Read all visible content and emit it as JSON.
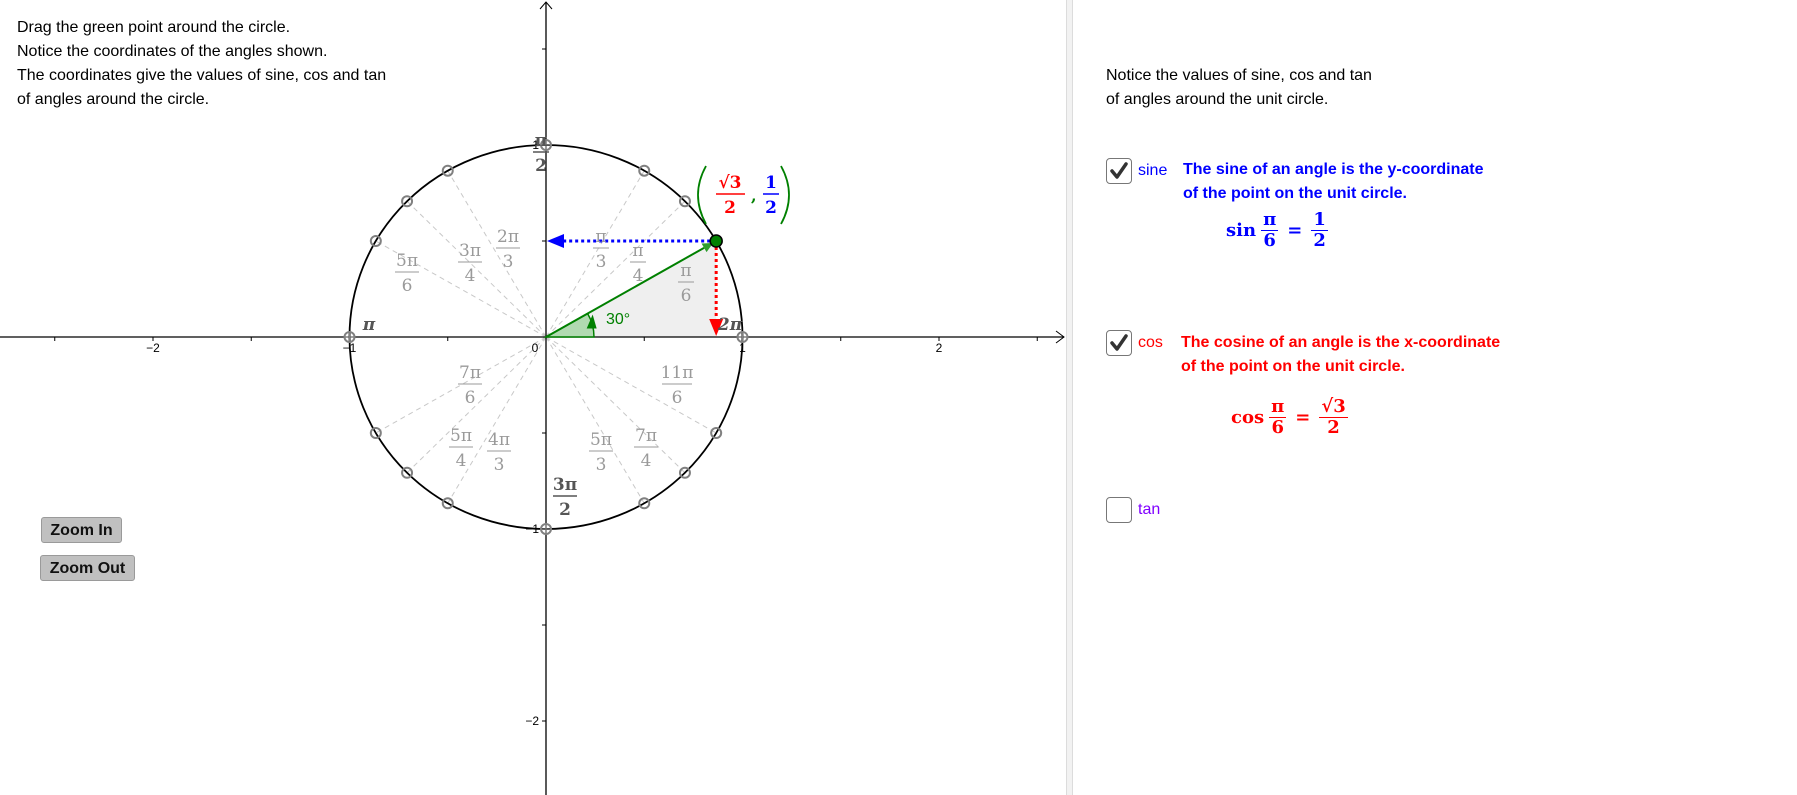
{
  "instructions_left": [
    "Drag the green point around the circle.",
    "Notice the coordinates of the angles shown.",
    "The coordinates give the values of sine, cos and tan",
    "of angles around the circle."
  ],
  "instructions_right": [
    "Notice the values of sine, cos and tan",
    "of angles around the unit circle."
  ],
  "buttons": {
    "zoom_in": "Zoom In",
    "zoom_out": "Zoom Out"
  },
  "graph": {
    "axes": {
      "x_ticks": [
        "−2",
        "−1",
        "0",
        "1",
        "2"
      ],
      "y_ticks": [
        "1",
        "−1",
        "−2"
      ]
    },
    "current_angle": {
      "degrees_label": "30°",
      "radians": "π/6",
      "point_coords": {
        "x_num": "√3",
        "x_den": "2",
        "y_num": "1",
        "y_den": "2"
      }
    },
    "angle_labels": [
      {
        "name": "0",
        "num": "2π",
        "den": "",
        "deg": 0
      },
      {
        "name": "pi-6",
        "num": "π",
        "den": "6",
        "deg": 30
      },
      {
        "name": "pi-4",
        "num": "π",
        "den": "4",
        "deg": 45
      },
      {
        "name": "pi-3",
        "num": "π",
        "den": "3",
        "deg": 60
      },
      {
        "name": "pi-2",
        "num": "π",
        "den": "2",
        "deg": 90
      },
      {
        "name": "2pi-3",
        "num": "2π",
        "den": "3",
        "deg": 120
      },
      {
        "name": "3pi-4",
        "num": "3π",
        "den": "4",
        "deg": 135
      },
      {
        "name": "5pi-6",
        "num": "5π",
        "den": "6",
        "deg": 150
      },
      {
        "name": "pi",
        "num": "π",
        "den": "",
        "deg": 180
      },
      {
        "name": "7pi-6",
        "num": "7π",
        "den": "6",
        "deg": 210
      },
      {
        "name": "5pi-4",
        "num": "5π",
        "den": "4",
        "deg": 225
      },
      {
        "name": "4pi-3",
        "num": "4π",
        "den": "3",
        "deg": 240
      },
      {
        "name": "3pi-2",
        "num": "3π",
        "den": "2",
        "deg": 270
      },
      {
        "name": "5pi-3",
        "num": "5π",
        "den": "3",
        "deg": 300
      },
      {
        "name": "7pi-4",
        "num": "7π",
        "den": "4",
        "deg": 315
      },
      {
        "name": "11pi-6",
        "num": "11π",
        "den": "6",
        "deg": 330
      }
    ]
  },
  "toggles": [
    {
      "id": "sine",
      "label": "sine",
      "checked": true,
      "color": "#0000ff",
      "description": [
        "The sine of an angle is the y-coordinate",
        "of the point on the unit circle."
      ],
      "formula": {
        "fn": "sin",
        "arg_num": "π",
        "arg_den": "6",
        "val_num": "1",
        "val_den": "2"
      }
    },
    {
      "id": "cos",
      "label": "cos",
      "checked": true,
      "color": "#ff0000",
      "description": [
        "The cosine of an angle is the x-coordinate",
        "of the point on the unit circle."
      ],
      "formula": {
        "fn": "cos",
        "arg_num": "π",
        "arg_den": "6",
        "val_num": "√3",
        "val_den": "2"
      }
    },
    {
      "id": "tan",
      "label": "tan",
      "checked": false,
      "color": "#7f00ff"
    }
  ],
  "colors": {
    "green": "#008000",
    "sine": "#0000ff",
    "cos": "#ff0000",
    "tan": "#7f00ff",
    "label_gray": "#999999"
  }
}
